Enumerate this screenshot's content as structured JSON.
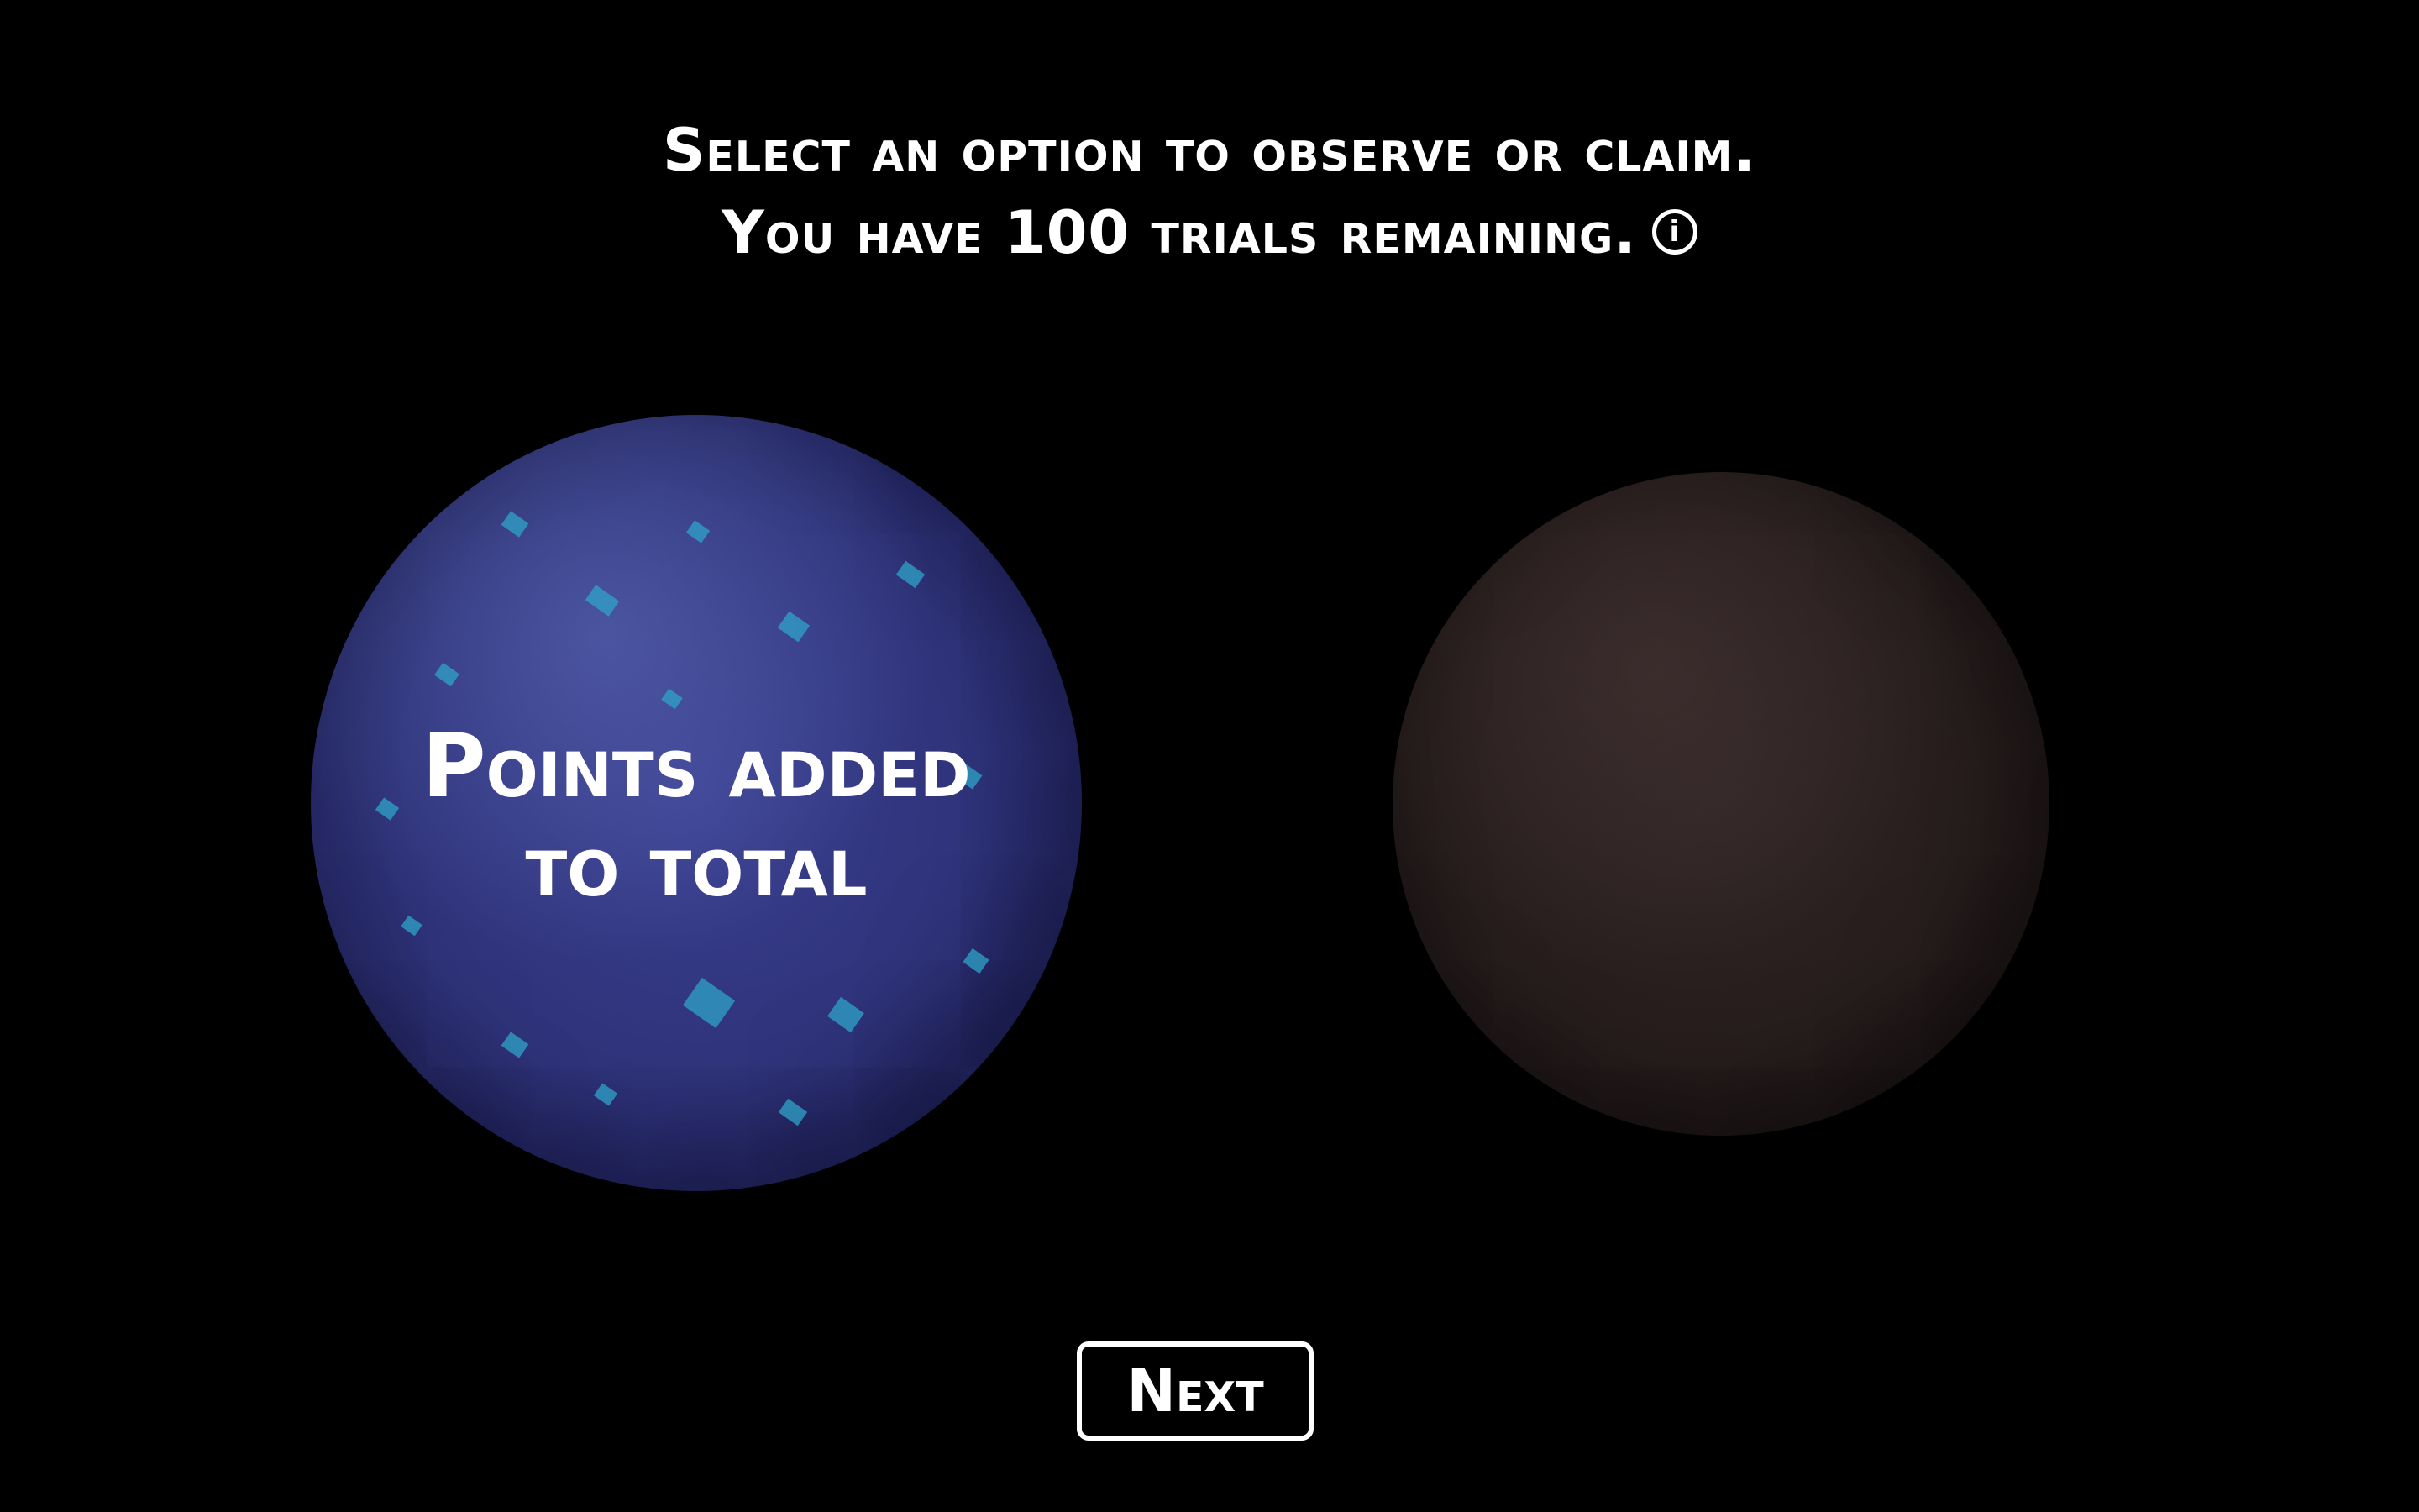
{
  "header": {
    "line1": "Select an option to observe or claim.",
    "line2": "You have 100 trials remaining.",
    "info_icon_glyph": "i"
  },
  "options": [
    {
      "name": "blue-planet",
      "label_line1": "Points added",
      "label_line2": "to total",
      "color": "#2e3278"
    },
    {
      "name": "brown-planet",
      "color": "#271d1d"
    }
  ],
  "next_button": {
    "label": "Next"
  },
  "icons": {
    "info": "info-circle-icon"
  }
}
